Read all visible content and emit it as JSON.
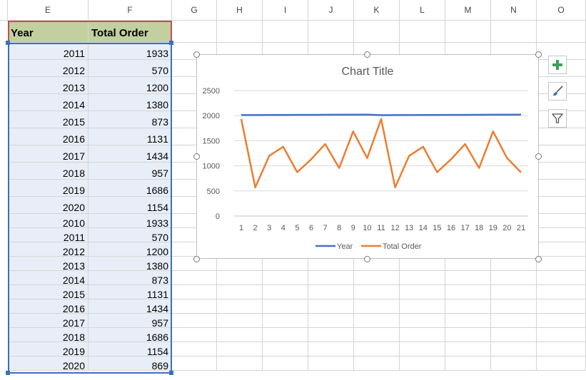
{
  "columns": [
    "E",
    "F",
    "G",
    "H",
    "I",
    "J",
    "K",
    "L",
    "M",
    "N",
    "O"
  ],
  "table": {
    "headers": [
      "Year",
      "Total Order"
    ],
    "rows": [
      [
        "2011",
        "1933"
      ],
      [
        "2012",
        "570"
      ],
      [
        "2013",
        "1200"
      ],
      [
        "2014",
        "1380"
      ],
      [
        "2015",
        "873"
      ],
      [
        "2016",
        "1131"
      ],
      [
        "2017",
        "1434"
      ],
      [
        "2018",
        "957"
      ],
      [
        "2019",
        "1686"
      ],
      [
        "2020",
        "1154"
      ],
      [
        "2010",
        "1933"
      ],
      [
        "2011",
        "570"
      ],
      [
        "2012",
        "1200"
      ],
      [
        "2013",
        "1380"
      ],
      [
        "2014",
        "873"
      ],
      [
        "2015",
        "1131"
      ],
      [
        "2016",
        "1434"
      ],
      [
        "2017",
        "957"
      ],
      [
        "2018",
        "1686"
      ],
      [
        "2019",
        "1154"
      ],
      [
        "2020",
        "869"
      ]
    ]
  },
  "chart_data": {
    "type": "line",
    "title": "Chart Title",
    "x": [
      1,
      2,
      3,
      4,
      5,
      6,
      7,
      8,
      9,
      10,
      11,
      12,
      13,
      14,
      15,
      16,
      17,
      18,
      19,
      20,
      21
    ],
    "ylim": [
      0,
      2500
    ],
    "yticks": [
      "0",
      "500",
      "1000",
      "1500",
      "2000",
      "2500"
    ],
    "grid": true,
    "legend_position": "bottom",
    "series": [
      {
        "name": "Year",
        "color": "#4472c4",
        "values": [
          2011,
          2012,
          2013,
          2014,
          2015,
          2016,
          2017,
          2018,
          2019,
          2020,
          2010,
          2011,
          2012,
          2013,
          2014,
          2015,
          2016,
          2017,
          2018,
          2019,
          2020
        ]
      },
      {
        "name": "Total Order",
        "color": "#ed7d31",
        "values": [
          1933,
          570,
          1200,
          1380,
          873,
          1131,
          1434,
          957,
          1686,
          1154,
          1933,
          570,
          1200,
          1380,
          873,
          1131,
          1434,
          957,
          1686,
          1154,
          869
        ]
      }
    ]
  },
  "chart_buttons": [
    {
      "icon": "plus-icon",
      "name": "chart-elements-button"
    },
    {
      "icon": "brush-icon",
      "name": "chart-styles-button"
    },
    {
      "icon": "filter-icon",
      "name": "chart-filters-button"
    }
  ]
}
